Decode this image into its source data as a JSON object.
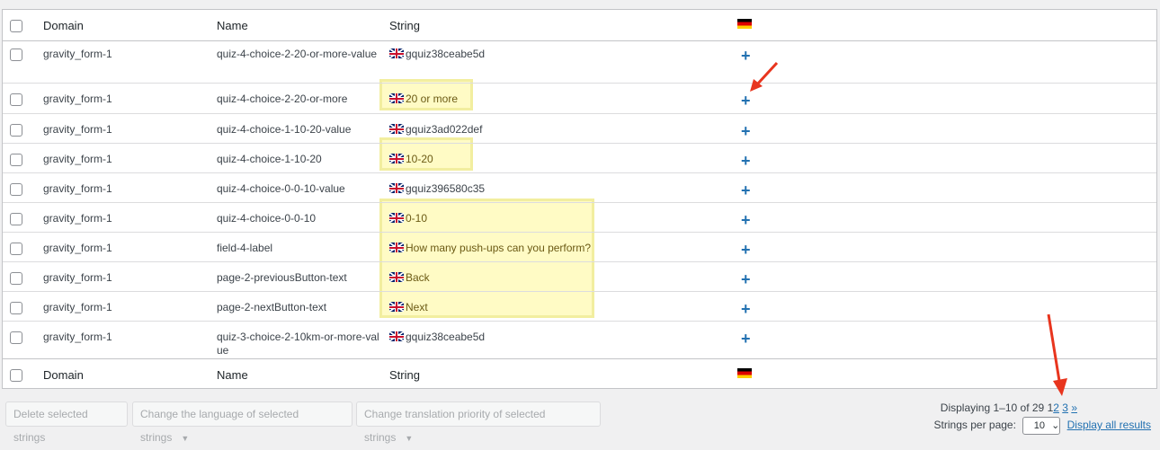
{
  "table": {
    "headers": {
      "domain": "Domain",
      "name": "Name",
      "string": "String"
    },
    "rows": [
      {
        "domain": "gravity_form-1",
        "name": "quiz-4-choice-2-20-or-more-value",
        "string": "gquiz38ceabe5d"
      },
      {
        "domain": "gravity_form-1",
        "name": "quiz-4-choice-2-20-or-more",
        "string": "20 or more"
      },
      {
        "domain": "gravity_form-1",
        "name": "quiz-4-choice-1-10-20-value",
        "string": "gquiz3ad022def"
      },
      {
        "domain": "gravity_form-1",
        "name": "quiz-4-choice-1-10-20",
        "string": "10-20"
      },
      {
        "domain": "gravity_form-1",
        "name": "quiz-4-choice-0-0-10-value",
        "string": "gquiz396580c35"
      },
      {
        "domain": "gravity_form-1",
        "name": "quiz-4-choice-0-0-10",
        "string": "0-10"
      },
      {
        "domain": "gravity_form-1",
        "name": "field-4-label",
        "string": "How many push-ups can you perform?"
      },
      {
        "domain": "gravity_form-1",
        "name": "page-2-previousButton-text",
        "string": "Back"
      },
      {
        "domain": "gravity_form-1",
        "name": "page-2-nextButton-text",
        "string": "Next"
      },
      {
        "domain": "gravity_form-1",
        "name": "quiz-3-choice-2-10km-or-more-value",
        "string": "gquiz38ceabe5d"
      }
    ],
    "add_translation_icon": "+"
  },
  "actions": {
    "delete": "Delete selected strings",
    "change_language": "Change the language of selected strings",
    "change_priority": "Change translation priority of selected strings"
  },
  "pagination": {
    "displaying": "Displaying 1–10 of 29",
    "current_page": "1",
    "page_2": "2",
    "page_3": "3",
    "next": "»",
    "per_page_label": "Strings per page:",
    "per_page_value": "10",
    "display_all": "Display all results"
  },
  "colors": {
    "highlight_bg": "#fffbc5",
    "highlight_border": "#f2ee9f",
    "arrow": "#e8351e",
    "link": "#2271b1"
  }
}
